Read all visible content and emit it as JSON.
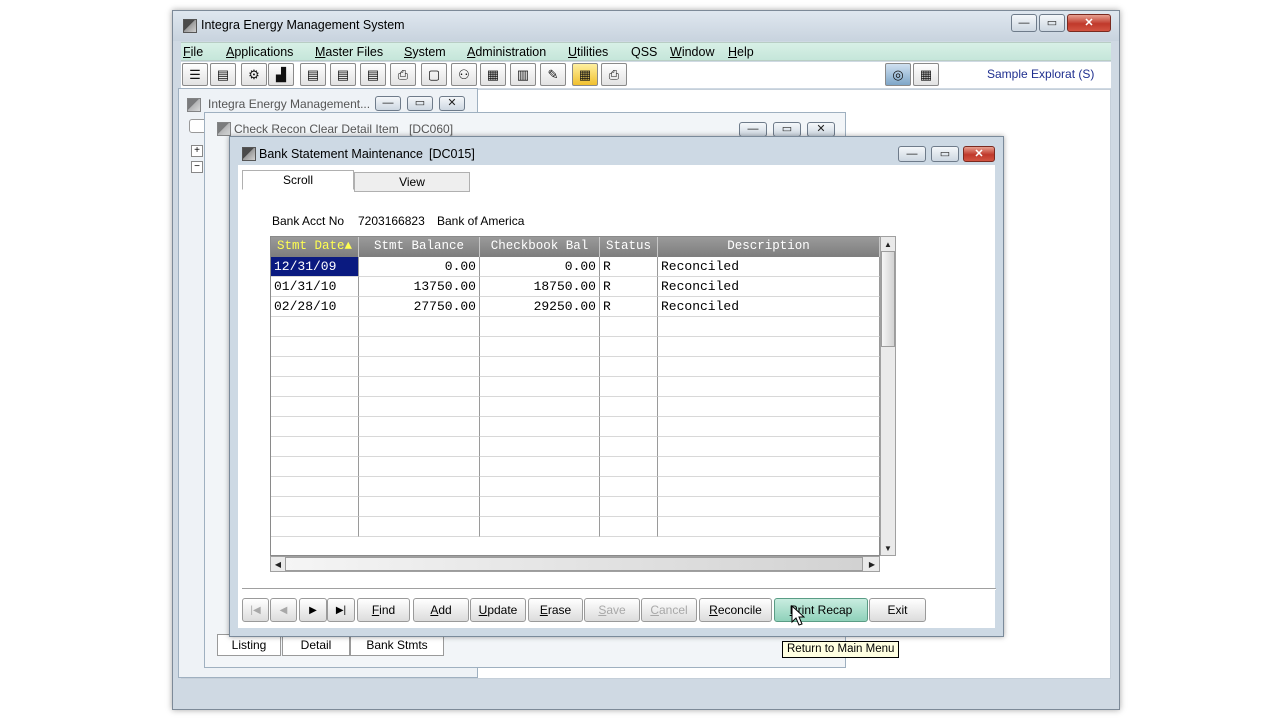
{
  "main_window": {
    "title": "Integra Energy Management System",
    "company": "Sample Explorat  (S)"
  },
  "menu": [
    {
      "label": "File",
      "underline": "F",
      "rest": "ile"
    },
    {
      "label": "Applications",
      "underline": "A",
      "rest": "pplications"
    },
    {
      "label": "Master Files",
      "underline": "M",
      "rest": "aster Files"
    },
    {
      "label": "System",
      "underline": "S",
      "rest": "ystem"
    },
    {
      "label": "Administration",
      "underline": "A",
      "rest": "dministration"
    },
    {
      "label": "Utilities",
      "underline": "U",
      "rest": "tilities"
    },
    {
      "label": "QSS",
      "underline": "",
      "rest": "QSS"
    },
    {
      "label": "Window",
      "underline": "W",
      "rest": "indow"
    },
    {
      "label": "Help",
      "underline": "H",
      "rest": "elp"
    }
  ],
  "toolbar_icons": [
    "list-icon",
    "book-icon",
    "gear-person-icon",
    "chart-icon",
    "document-list-icon",
    "document-list-2-icon",
    "document-list-3-icon",
    "printer-icon",
    "print-preview-icon",
    "org-chart-icon",
    "calendar-grid-icon",
    "report-icon",
    "tools-icon",
    "colored-grid-icon",
    "printer-scanner-icon"
  ],
  "bg_window_1": {
    "title": "Integra Energy Management...",
    "tabs": [
      "Listing",
      "Detail",
      "Bank Stmts"
    ]
  },
  "bg_window_2": {
    "title": "Check Recon Clear Detail Item",
    "code": "[DC060]"
  },
  "front_window": {
    "title": "Bank Statement Maintenance",
    "code": "[DC015]",
    "tabs": [
      "Scroll",
      "View"
    ],
    "bank_acct_label": "Bank Acct No",
    "bank_acct_no": "7203166823",
    "bank_name": "Bank of America"
  },
  "grid": {
    "columns": [
      "Stmt Date",
      "Stmt Balance",
      "Checkbook Bal",
      "Status",
      "Description"
    ],
    "sort_indicator": "▲",
    "rows": [
      [
        "12/31/09",
        "0.00",
        "0.00",
        "R",
        "Reconciled"
      ],
      [
        "01/31/10",
        "13750.00",
        "18750.00",
        "R",
        "Reconciled"
      ],
      [
        "02/28/10",
        "27750.00",
        "29250.00",
        "R",
        "Reconciled"
      ]
    ],
    "empty_rows": 11
  },
  "buttons": [
    {
      "label": "Find",
      "u": "F",
      "rest": "ind",
      "disabled": false
    },
    {
      "label": "Add",
      "u": "A",
      "rest": "dd",
      "disabled": false
    },
    {
      "label": "Update",
      "u": "U",
      "rest": "pdate",
      "disabled": false
    },
    {
      "label": "Erase",
      "u": "E",
      "rest": "rase",
      "disabled": false
    },
    {
      "label": "Save",
      "u": "S",
      "rest": "ave",
      "disabled": true
    },
    {
      "label": "Cancel",
      "u": "C",
      "rest": "ancel",
      "disabled": true
    },
    {
      "label": "Reconcile",
      "u": "R",
      "rest": "econcile",
      "disabled": false
    },
    {
      "label": "Print Recap",
      "u": "P",
      "rest": "rint Recap",
      "disabled": false
    },
    {
      "label": "Exit",
      "u": "",
      "rest": "Exit",
      "disabled": false
    }
  ],
  "nav_buttons": [
    "first-record-icon",
    "prev-record-icon",
    "next-record-icon",
    "last-record-icon"
  ],
  "tooltip": "Return to Main Menu"
}
